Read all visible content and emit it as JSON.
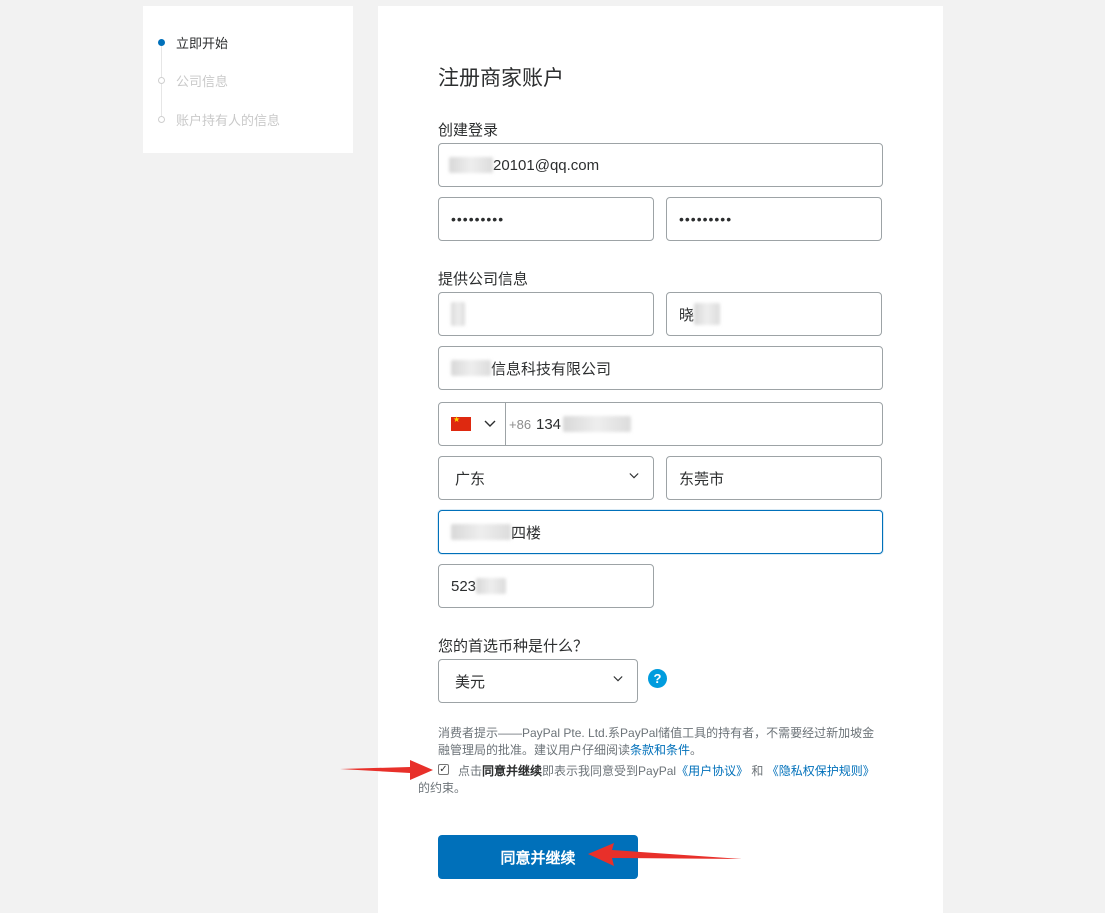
{
  "sidebar": {
    "steps": [
      {
        "label": "立即开始",
        "state": "active"
      },
      {
        "label": "公司信息",
        "state": "inactive"
      },
      {
        "label": "账户持有人的信息",
        "state": "inactive"
      }
    ]
  },
  "form": {
    "title": "注册商家账户",
    "login_section": "创建登录",
    "email_value": "20101@qq.com",
    "password_value": "•••••••••",
    "confirm_password_value": "•••••••••",
    "company_section": "提供公司信息",
    "first_name_value": "晓",
    "company_name_value": "信息科技有限公司",
    "phone_country_code": "+86",
    "phone_value": "134",
    "province_value": "广东",
    "city_value": "东莞市",
    "address_value": "四楼",
    "postal_code_value": "523",
    "currency_question": "您的首选币种是什么？",
    "currency_value": "美元",
    "help_icon_glyph": "?",
    "notice_text": "消费者提示——PayPal Pte. Ltd.系PayPal储值工具的持有者，不需要经过新加坡金融管理局的批准。建议用户仔细阅读",
    "notice_link": "条款和条件",
    "notice_end": "。",
    "agree_prefix": "点击",
    "agree_bold": "同意并继续",
    "agree_mid": "即表示我同意受到PayPal",
    "agree_link1": "《用户协议》",
    "agree_and": "和",
    "agree_link2": "《隐私权保护规则》",
    "agree_suffix": "的约束。",
    "agree_checked": true,
    "submit_label": "同意并继续"
  },
  "colors": {
    "primary": "#0070ba",
    "help": "#009cde",
    "annotation_arrow": "#e8302a",
    "flag": "#de2910"
  }
}
